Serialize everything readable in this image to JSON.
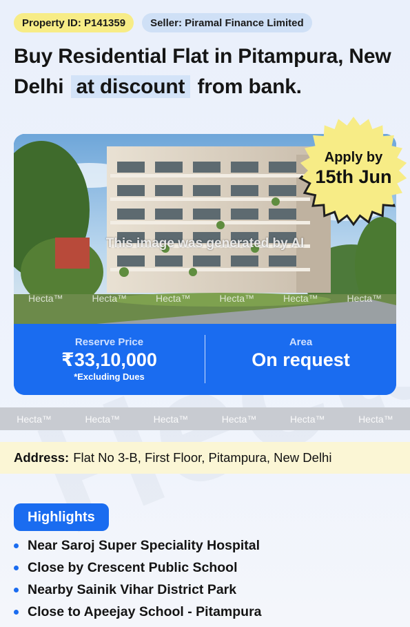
{
  "property_id": "Property ID: P141359",
  "seller": "Seller: Piramal Finance Limited",
  "title": {
    "part1": "Buy Residential Flat in Pitampura, New Delhi",
    "highlight": "at discount",
    "part2": "from bank."
  },
  "badge": {
    "line1": "Apply by",
    "line2": "15th Jun"
  },
  "image": {
    "ai_note": "This image was generated by AI",
    "watermark": "Hecta™"
  },
  "price": {
    "reserve_label": "Reserve Price",
    "reserve_value": "₹33,10,000",
    "reserve_note": "*Excluding Dues",
    "area_label": "Area",
    "area_value": "On request"
  },
  "strip_watermark": "Hecta™",
  "address": {
    "label": "Address:",
    "value": "Flat No 3-B, First Floor, Pitampura, New Delhi"
  },
  "highlights": {
    "label": "Highlights",
    "items": [
      "Near Saroj Super Speciality Hospital",
      "Close by Crescent Public School",
      "Nearby Sainik Vihar District Park",
      "Close to Apeejay School - Pitampura"
    ]
  },
  "background_watermark": "Hecta™",
  "colors": {
    "primary_blue": "#1a6cf0",
    "pill_yellow": "#f7ec86",
    "pill_blue": "#cfe0f6",
    "badge_yellow": "#f7ec86",
    "address_bg": "#fbf6d5"
  }
}
